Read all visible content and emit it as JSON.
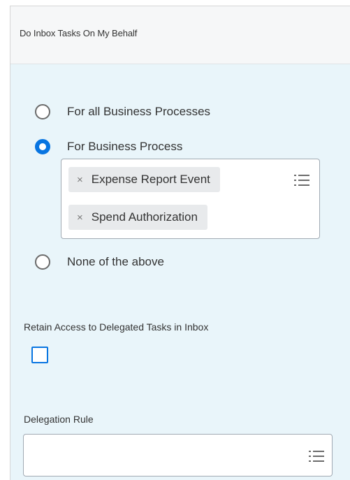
{
  "header": {
    "title": "Do Inbox Tasks On My Behalf"
  },
  "scope": {
    "options": [
      {
        "label": "For all Business Processes",
        "selected": false
      },
      {
        "label": "For Business Process",
        "selected": true
      },
      {
        "label": "None of the above",
        "selected": false
      }
    ],
    "selected_processes": [
      {
        "remove": "×",
        "label": "Expense Report Event"
      },
      {
        "remove": "×",
        "label": "Spend Authorization"
      }
    ]
  },
  "retain_access": {
    "label": "Retain Access to Delegated Tasks in Inbox",
    "checked": false
  },
  "delegation_rule": {
    "label": "Delegation Rule",
    "value": ""
  },
  "icons": {
    "prompt": "list-icon",
    "remove": "close-icon"
  },
  "colors": {
    "accent": "#0875e1",
    "panel": "#e9f5fa",
    "header": "#f6f7f8"
  }
}
